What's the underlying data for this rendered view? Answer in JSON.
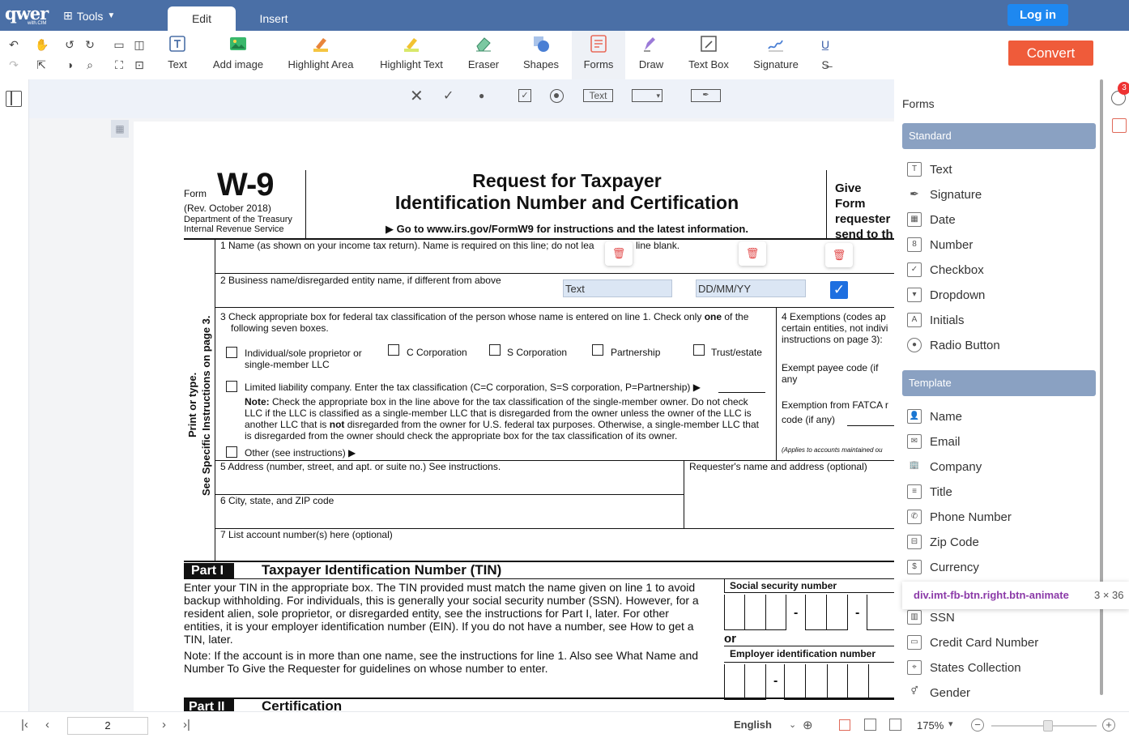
{
  "app": {
    "logo": "qwer",
    "logo_sub": "with.CIM",
    "tools_label": "Tools",
    "tabs": [
      "Edit",
      "Insert"
    ],
    "login_label": "Log in",
    "convert_label": "Convert"
  },
  "toolbar": {
    "tools": [
      "Text",
      "Add image",
      "Highlight Area",
      "Highlight Text",
      "Eraser",
      "Shapes",
      "Forms",
      "Draw",
      "Text Box",
      "Signature"
    ],
    "active_tool": "Forms"
  },
  "subbar": {
    "text_button": "Text"
  },
  "form": {
    "form_label": "Form",
    "form_number": "W-9",
    "rev": "(Rev. October 2018)",
    "dept1": "Department of the Treasury",
    "dept2": "Internal Revenue Service",
    "title1": "Request for Taxpayer",
    "title2": "Identification Number and Certification",
    "goto": "▶ Go to www.irs.gov/FormW9 for instructions and the latest information.",
    "give1": "Give Form",
    "give2": "requester",
    "give3": "send to th",
    "line1": "1  Name (as shown on your income tax return). Name is required on this line; do not lea",
    "line1b": "line blank.",
    "line2": "2  Business name/disregarded entity name, if different from above",
    "field_text": "Text",
    "field_date": "DD/MM/YY",
    "line3a": "3  Check appropriate box for federal tax classification of the person whose name is entered on line 1. Check only",
    "line3one": "one",
    "line3c": "of the",
    "line3b": "following seven boxes.",
    "opt_individual1": "Individual/sole proprietor or",
    "opt_individual2": "single-member LLC",
    "opt_c": "C Corporation",
    "opt_s": "S Corporation",
    "opt_partnership": "Partnership",
    "opt_trust": "Trust/estate",
    "opt_llc": "Limited liability company. Enter the tax classification (C=C corporation, S=S corporation, P=Partnership) ▶",
    "note_label": "Note:",
    "note1": "Check the appropriate box in the line above for the tax classification of the single-member owner.  Do not check",
    "note2": "LLC if the LLC is classified as a single-member LLC that is disregarded from the owner unless the owner of the LLC is",
    "note3a": "another LLC that is",
    "note3not": "not",
    "note3b": "disregarded from the owner for U.S. federal tax purposes. Otherwise, a single-member LLC that",
    "note4": "is disregarded from the owner should check the appropriate box for the tax classification of its owner.",
    "opt_other": "Other (see instructions) ▶",
    "ex4a": "4  Exemptions (codes ap",
    "ex4b": "certain entities, not indivi",
    "ex4c": "instructions on page 3):",
    "ex_payee": "Exempt payee code (if any",
    "ex_fatca1": "Exemption from FATCA r",
    "ex_fatca2": "code (if any)",
    "ex_applies": "(Applies to accounts maintained ou",
    "line5": "5  Address (number, street, and apt. or suite no.) See instructions.",
    "requester": "Requester's name and address (optional)",
    "line6": "6  City, state, and ZIP code",
    "line7": "7  List account number(s) here (optional)",
    "side1": "Print or type.",
    "side2": "See Specific Instructions on page 3.",
    "part1": "Part I",
    "part1_title": "Taxpayer Identification Number (TIN)",
    "tin1": "Enter your TIN in the appropriate box. The TIN provided must match the name given on line 1 to avoid",
    "tin2": "backup withholding. For individuals, this is generally your social security number (SSN). However, for a",
    "tin3": "resident alien, sole proprietor, or disregarded entity, see the instructions for Part I, later. For other",
    "tin4": "entities, it is your employer identification number (EIN). If you do not have a number, see How to get a",
    "tin5": "TIN, later.",
    "tin_note1": "Note: If the account is in more than one name, see the instructions for line 1. Also see What Name and",
    "tin_note2": "Number To Give the Requester for guidelines on whose number to enter.",
    "ssn": "Social security number",
    "or": "or",
    "ein": "Employer identification number",
    "part2": "Part II",
    "part2_title": "Certification"
  },
  "panel": {
    "title": "Forms",
    "standard_label": "Standard",
    "standard": [
      "Text",
      "Signature",
      "Date",
      "Number",
      "Checkbox",
      "Dropdown",
      "Initials",
      "Radio Button"
    ],
    "template_label": "Template",
    "template": [
      "Name",
      "Email",
      "Company",
      "Title",
      "Phone Number",
      "Zip Code",
      "Currency",
      "SSN",
      "Credit Card Number",
      "States Collection",
      "Gender"
    ],
    "tooltip_selector": "div.imt-fb-btn.right.btn-animate",
    "tooltip_size": "3 × 36",
    "badge": "3"
  },
  "bottom": {
    "page": "2",
    "language": "English",
    "zoom": "175%"
  },
  "colors": {
    "topbar": "#4a6fa6",
    "convert": "#ef5b3a",
    "login": "#1e88f0",
    "section": "#8aa1c2"
  }
}
